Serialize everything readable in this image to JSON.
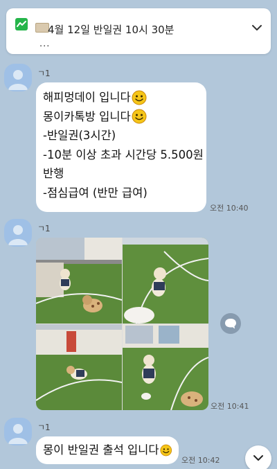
{
  "notice": {
    "title": "4월 12일 반일권 10시 30분",
    "more": "...",
    "icon": "notice-graph-icon",
    "accent": "#25b54a"
  },
  "messages": [
    {
      "sender": "ㄱ1",
      "lines": [
        "해피멍데이 입니다",
        "몽이카톡방 입니다",
        "-반일권(3시간)",
        "-10분 이상 초과 시간당 5.500원",
        "반행",
        "-점심급여 (반만 급여)"
      ],
      "time": "오전 10:40"
    },
    {
      "sender": "ㄱ1",
      "photos": 4,
      "time": "오전 10:41"
    },
    {
      "sender": "ㄱ1",
      "text": "몽이 반일권 출석 입니다",
      "time": "오전 10:42"
    }
  ],
  "colors": {
    "background": "#b2c7da",
    "bubble": "#ffffff",
    "avatar": "#9fc0e6"
  }
}
